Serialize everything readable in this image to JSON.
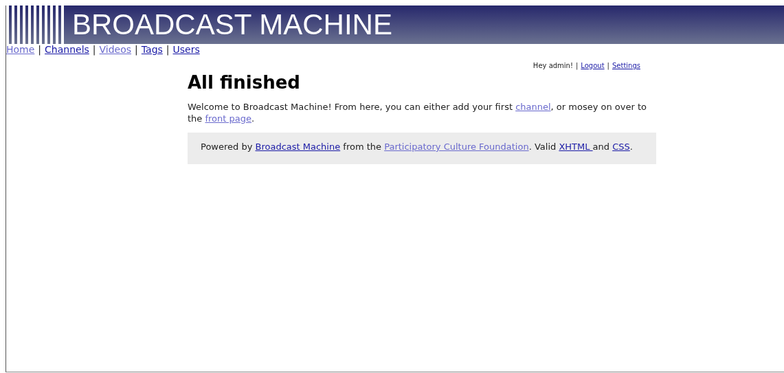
{
  "banner": {
    "title": "BROADCAST MACHINE"
  },
  "nav_separator": "|",
  "nav": [
    {
      "label": "Home",
      "visited": true
    },
    {
      "label": "Channels",
      "visited": false
    },
    {
      "label": "Videos",
      "visited": true
    },
    {
      "label": "Tags",
      "visited": false
    },
    {
      "label": "Users",
      "visited": false
    }
  ],
  "user_bar": {
    "greeting": "Hey admin!",
    "separator": "|",
    "links": [
      {
        "label": "Logout",
        "visited": false
      },
      {
        "label": "Settings",
        "visited": false
      }
    ]
  },
  "heading": "All finished",
  "welcome": [
    {
      "kind": "text",
      "text": "Welcome to Broadcast Machine! From here, you can either add your first "
    },
    {
      "kind": "link",
      "text": "channel",
      "visited": true
    },
    {
      "kind": "text",
      "text": ", or mosey on over to the "
    },
    {
      "kind": "link",
      "text": "front page",
      "visited": true
    },
    {
      "kind": "text",
      "text": "."
    }
  ],
  "footer": [
    {
      "kind": "text",
      "text": "Powered by "
    },
    {
      "kind": "link",
      "text": "Broadcast Machine",
      "visited": false
    },
    {
      "kind": "text",
      "text": " from the "
    },
    {
      "kind": "link",
      "text": "Participatory Culture Foundation",
      "visited": true
    },
    {
      "kind": "text",
      "text": ". Valid "
    },
    {
      "kind": "link",
      "text": "XHTML ",
      "visited": false
    },
    {
      "kind": "text",
      "text": "and "
    },
    {
      "kind": "link",
      "text": "CSS",
      "visited": false
    },
    {
      "kind": "text",
      "text": "."
    }
  ]
}
